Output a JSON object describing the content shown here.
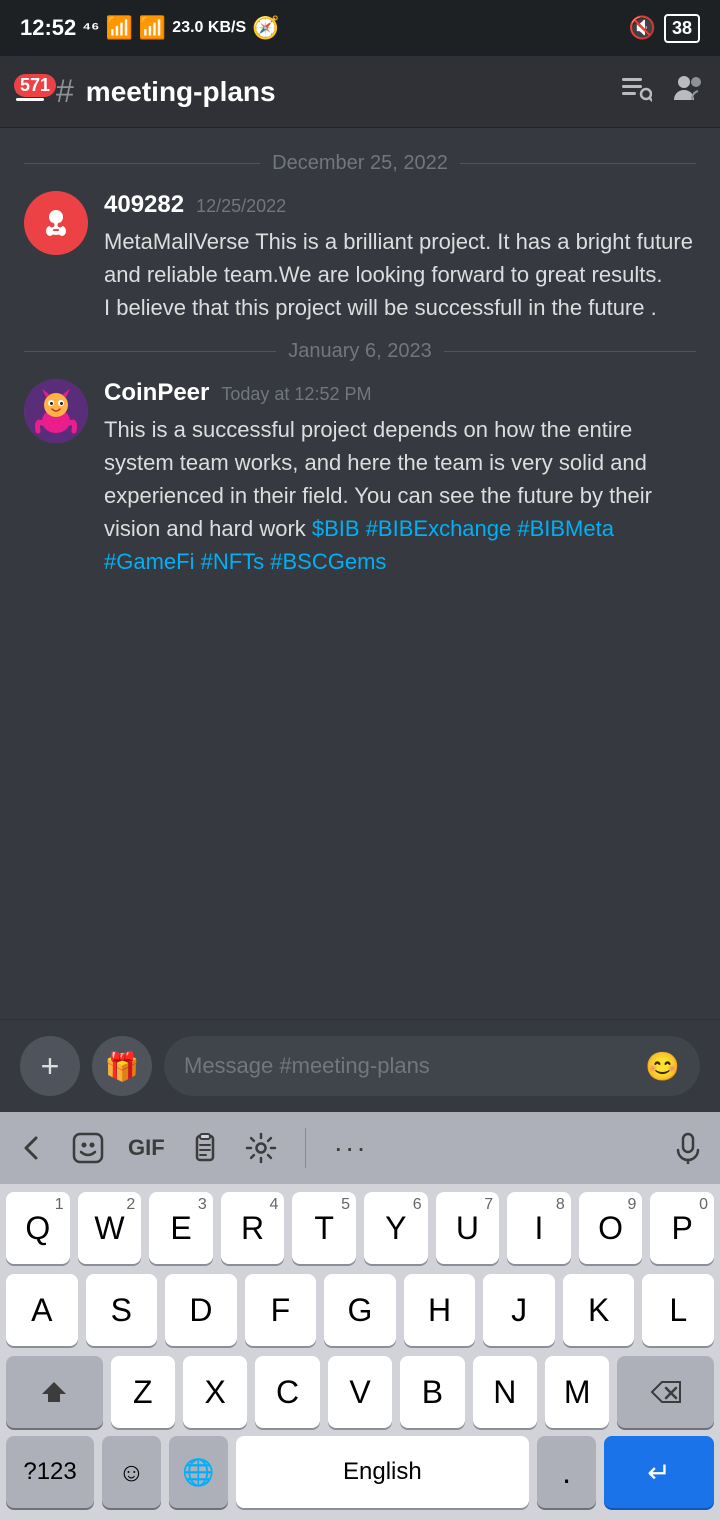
{
  "statusBar": {
    "time": "12:52",
    "signal1": "4G",
    "dataSpeed": "23.0 KB/S",
    "battery": "38"
  },
  "header": {
    "badge": "571",
    "channelSymbol": "#",
    "channelName": "meeting-plans"
  },
  "dateSeparators": {
    "dec25": "December 25, 2022",
    "jan6": "January 6, 2023"
  },
  "messages": [
    {
      "username": "409282",
      "timestamp": "12/25/2022",
      "text": "MetaMallVerse This is a brilliant project. It has a bright future and reliable team.We are looking forward to great results.\nI believe that this project will be successfull in the future ."
    },
    {
      "username": "CoinPeer",
      "timestamp": "Today at 12:52 PM",
      "text": "This is a successful project depends on how the entire system team works, and here the team is very solid and experienced in their field. You can see the future by their vision and hard work $BIB #BIBExchange #BIBMeta #GameFi #NFTs #BSCGems"
    }
  ],
  "inputBar": {
    "placeholder": "Message #meeting-plans"
  },
  "keyboard": {
    "rows": [
      [
        "Q",
        "W",
        "E",
        "R",
        "T",
        "Y",
        "U",
        "I",
        "O",
        "P"
      ],
      [
        "A",
        "S",
        "D",
        "F",
        "G",
        "H",
        "J",
        "K",
        "L"
      ],
      [
        "Z",
        "X",
        "C",
        "V",
        "B",
        "N",
        "M"
      ]
    ],
    "numbers": [
      "1",
      "2",
      "3",
      "4",
      "5",
      "6",
      "7",
      "8",
      "9",
      "0"
    ],
    "bottomRow": {
      "numeric": "?123",
      "space": "English",
      "period": ".",
      "return": "↵"
    }
  }
}
